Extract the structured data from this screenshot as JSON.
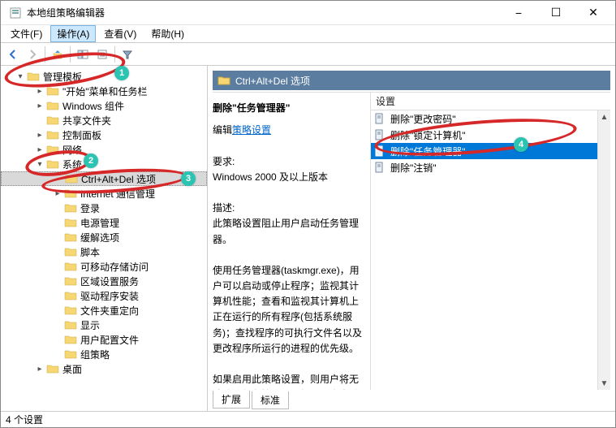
{
  "window": {
    "title": "本地组策略编辑器"
  },
  "menu": {
    "file": "文件(F)",
    "action": "操作(A)",
    "view": "查看(V)",
    "help": "帮助(H)"
  },
  "tree": {
    "root": "管理模板",
    "start_taskbar": "\"开始\"菜单和任务栏",
    "windows_components": "Windows 组件",
    "shared_folders": "共享文件夹",
    "control_panel": "控制面板",
    "network": "网络",
    "system": "系统",
    "ctrl_alt_del": "Ctrl+Alt+Del 选项",
    "internet_comm": "Internet 通信管理",
    "logon": "登录",
    "power_mgmt": "电源管理",
    "mitigation": "缓解选项",
    "scripts": "脚本",
    "removable": "可移动存储访问",
    "locale": "区域设置服务",
    "driver_install": "驱动程序安装",
    "folder_redirect": "文件夹重定向",
    "display": "显示",
    "user_profiles": "用户配置文件",
    "group_policy": "组策略",
    "desktop": "桌面"
  },
  "right": {
    "header": "Ctrl+Alt+Del 选项",
    "desc_title": "删除\"任务管理器\"",
    "edit_link_prefix": "编辑",
    "edit_link": "策略设置",
    "req_label": "要求:",
    "requirements": "Windows 2000 及以上版本",
    "desc_label": "描述:",
    "desc_p1": "此策略设置阻止用户启动任务管理器。",
    "desc_p2": "使用任务管理器(taskmgr.exe)，用户可以启动或停止程序；监视其计算机性能；查看和监视其计算机上正在运行的所有程序(包括系统服务)；查找程序的可执行文件名以及更改程序所运行的进程的优先级。",
    "desc_p3": "如果启用此策略设置，则用户将无法访问任务管理器。如果用户尝试启动任务管理器，则将显示一条消"
  },
  "list": {
    "header": "设置",
    "items": [
      "删除\"更改密码\"",
      "删除\"锁定计算机\"",
      "删除\"任务管理器\"",
      "删除\"注销\""
    ]
  },
  "tabs": {
    "extended": "扩展",
    "standard": "标准"
  },
  "status": "4 个设置",
  "badges": {
    "b1": "1",
    "b2": "2",
    "b3": "3",
    "b4": "4"
  }
}
